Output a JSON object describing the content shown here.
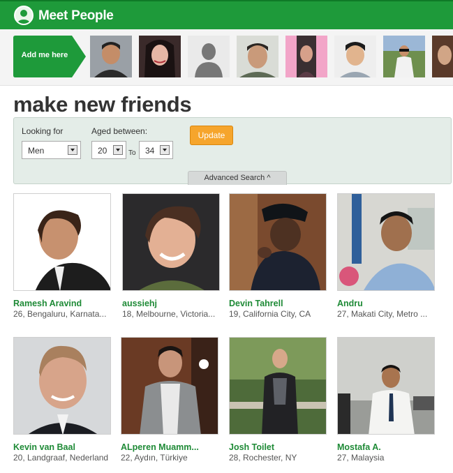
{
  "header": {
    "title": "Meet People",
    "accent": "#1e9a3a"
  },
  "strip": {
    "add_label": "Add me here",
    "thumb_count": 9
  },
  "main": {
    "heading": "make new friends"
  },
  "search": {
    "looking_for_label": "Looking for",
    "looking_for_value": "Men",
    "aged_label": "Aged between:",
    "age_from": "20",
    "to_label": "To",
    "age_to": "34",
    "update_label": "Update",
    "advanced_label": "Advanced Search ^",
    "button_color": "#f6a52c"
  },
  "profiles": [
    {
      "name": "Ramesh Aravind",
      "info": "26, Bengaluru, Karnata..."
    },
    {
      "name": "aussiehj",
      "info": "18, Melbourne, Victoria..."
    },
    {
      "name": "Devin Tahrell",
      "info": "19, California City, CA"
    },
    {
      "name": "Andru",
      "info": "27, Makati City, Metro ..."
    },
    {
      "name": "Kevin van Baal",
      "info": "20, Landgraaf, Nederland"
    },
    {
      "name": "ALperen Muamm...",
      "info": "22, Aydın, Türkiye"
    },
    {
      "name": "Josh Toilet",
      "info": "28, Rochester, NY"
    },
    {
      "name": "Mostafa A.",
      "info": "27, Malaysia"
    }
  ]
}
